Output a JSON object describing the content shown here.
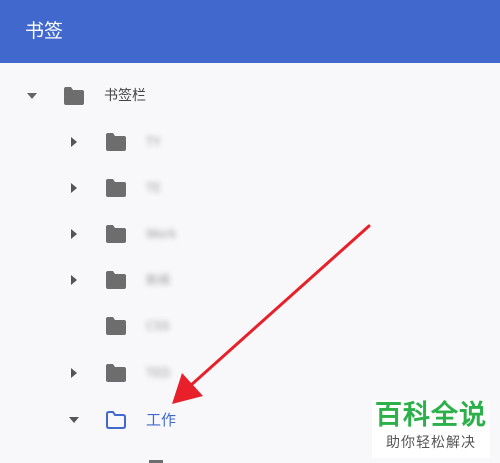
{
  "header": {
    "title": "书签"
  },
  "tree": [
    {
      "id": "root",
      "label": "书签栏",
      "expanded": true,
      "blurred": false
    },
    {
      "id": "item-1",
      "label": "TY",
      "expanded": false,
      "blurred": true
    },
    {
      "id": "item-2",
      "label": "TE",
      "expanded": false,
      "blurred": true
    },
    {
      "id": "item-3",
      "label": "Work",
      "expanded": false,
      "blurred": true
    },
    {
      "id": "item-4",
      "label": "新闻",
      "expanded": false,
      "blurred": true
    },
    {
      "id": "item-5",
      "label": "CSS",
      "expanded": false,
      "blurred": true
    },
    {
      "id": "item-6",
      "label": "TED",
      "expanded": false,
      "blurred": true
    },
    {
      "id": "work",
      "label": "工作",
      "expanded": true,
      "blurred": false,
      "selected": true
    },
    {
      "id": "child",
      "label": "",
      "expanded": false,
      "blurred": true
    }
  ],
  "colors": {
    "header": "#4169cd",
    "folder": "#6d6d6d",
    "selected": "#4169cd",
    "arrow": "#e8202a",
    "watermark": "#2bb04a"
  },
  "icons": {
    "expand": "triangle-down-icon",
    "collapse": "triangle-right-icon",
    "folder": "folder-icon",
    "folder_open": "folder-outline-icon"
  },
  "watermark": {
    "title": "百科全说",
    "subtitle": "助你轻松解决"
  }
}
